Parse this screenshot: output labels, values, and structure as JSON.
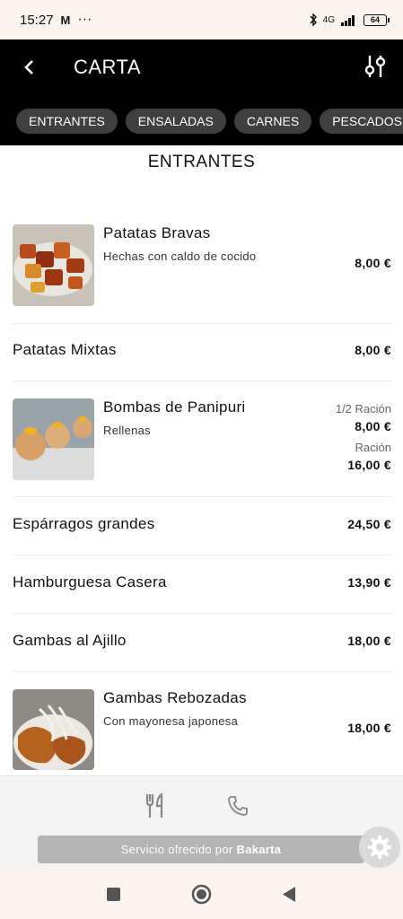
{
  "status_bar": {
    "time": "15:27",
    "mail_icon": "M",
    "dots": "···",
    "network": "4G",
    "battery": "64"
  },
  "header": {
    "title": "CARTA"
  },
  "tabs": [
    {
      "label": "ENTRANTES"
    },
    {
      "label": "ENSALADAS"
    },
    {
      "label": "CARNES"
    },
    {
      "label": "PESCADOS"
    }
  ],
  "section": {
    "title": "ENTRANTES"
  },
  "items": [
    {
      "name": "Patatas Bravas",
      "description": "Hechas con caldo de cocido",
      "price": "8,00 €"
    },
    {
      "name": "Patatas Mixtas",
      "price": "8,00 €"
    },
    {
      "name": "Bombas de Panipuri",
      "description": "Rellenas",
      "portions": [
        {
          "label": "1/2 Ración",
          "price": "8,00 €"
        },
        {
          "label": "Ración",
          "price": "16,00 €"
        }
      ]
    },
    {
      "name": "Espárragos grandes",
      "price": "24,50 €"
    },
    {
      "name": "Hamburguesa Casera",
      "price": "13,90 €"
    },
    {
      "name": "Gambas al Ajillo",
      "price": "18,00 €"
    },
    {
      "name": "Gambas Rebozadas",
      "description": "Con mayonesa japonesa",
      "price": "18,00 €"
    }
  ],
  "footer": {
    "service_text": "Servicio ofrecido por",
    "service_brand": "Bakarta"
  },
  "icons": [
    "back-arrow",
    "filter-sliders",
    "cutlery",
    "phone",
    "gear",
    "square",
    "circle",
    "triangle-back"
  ]
}
